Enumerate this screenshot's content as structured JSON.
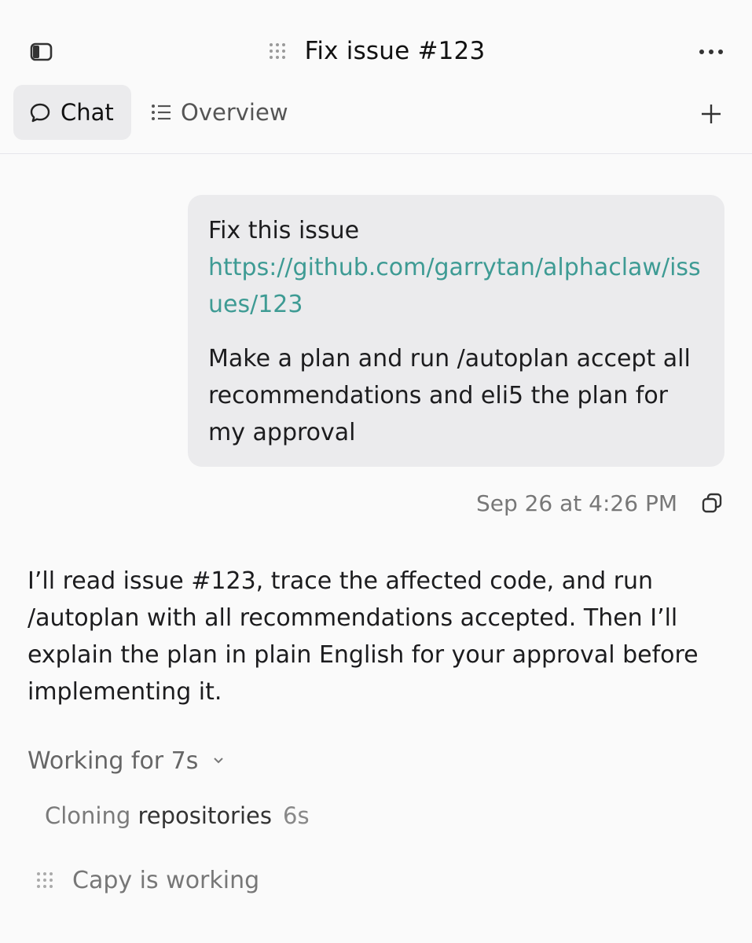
{
  "header": {
    "title": "Fix issue #123",
    "sidebar_toggle_icon": "sidebar-toggle-icon",
    "more_icon": "ellipsis-icon"
  },
  "tabs": [
    {
      "label": "Chat",
      "icon": "chat-bubble-icon",
      "active": true
    },
    {
      "label": "Overview",
      "icon": "list-icon",
      "active": false
    }
  ],
  "add_icon": "plus-icon",
  "user_message": {
    "line1": "Fix this issue",
    "link": "https://github.com/garrytan/alphaclaw/issues/123",
    "body": "Make a plan and run /autoplan accept all recommendations and eli5 the plan for my approval",
    "timestamp": "Sep 26 at 4:26 PM"
  },
  "assistant_message": {
    "text": "I’ll read issue #123, trace the affected code, and run /autoplan with all recommendations accepted. Then I’ll explain the plan in plain English for your approval before implementing it."
  },
  "working": {
    "label": "Working for 7s",
    "step_label_light": "Cloning ",
    "step_label_dark": "repositories",
    "step_time": "6s",
    "status": "Capy is working"
  },
  "colors": {
    "link": "#3e9b94",
    "bubble": "#ebebed",
    "background": "#fafafa"
  }
}
